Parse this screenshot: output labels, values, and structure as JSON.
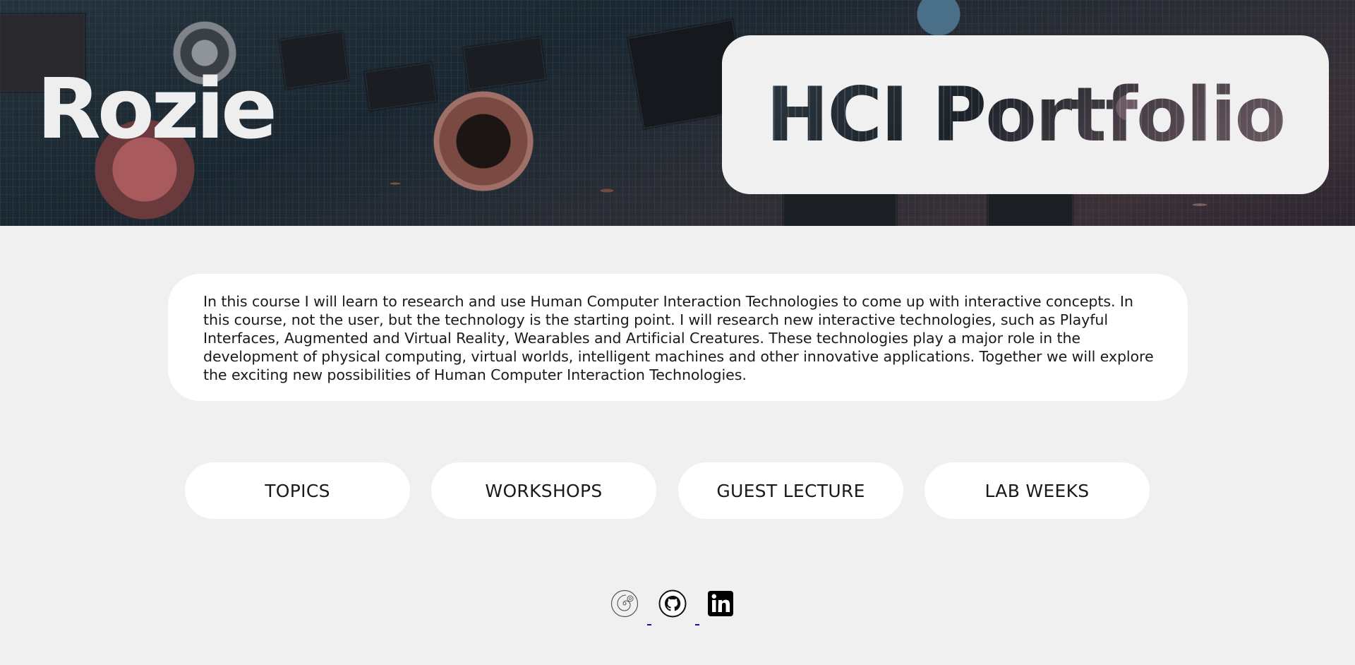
{
  "hero": {
    "name": "Rozie",
    "title": "HCI Portfolio"
  },
  "description": {
    "text": "In this course I will learn to research and use Human Computer Interaction Technologies to come up with interactive concepts. In this course, not the user, but the technology is the starting point. I will research new interactive technologies, such as Playful Interfaces, Augmented and Virtual Reality, Wearables and Artificial Creatures. These technologies play a major role in the development of physical computing, virtual worlds, intelligent machines and other innovative applications. Together we will explore the exciting new possibilities of Human Computer Interaction Technologies."
  },
  "nav": {
    "items": [
      {
        "label": "TOPICS"
      },
      {
        "label": "WORKSHOPS"
      },
      {
        "label": "GUEST LECTURE"
      },
      {
        "label": "LAB WEEKS"
      }
    ]
  },
  "footer": {
    "icons": [
      {
        "icon": "spiral-logo-icon"
      },
      {
        "icon": "github-icon"
      },
      {
        "icon": "linkedin-icon"
      }
    ]
  },
  "colors": {
    "page_background": "#f0f0f0",
    "card_background": "#ffffff",
    "text": "#1a1a1a",
    "link_underline": "#1a0dab"
  }
}
